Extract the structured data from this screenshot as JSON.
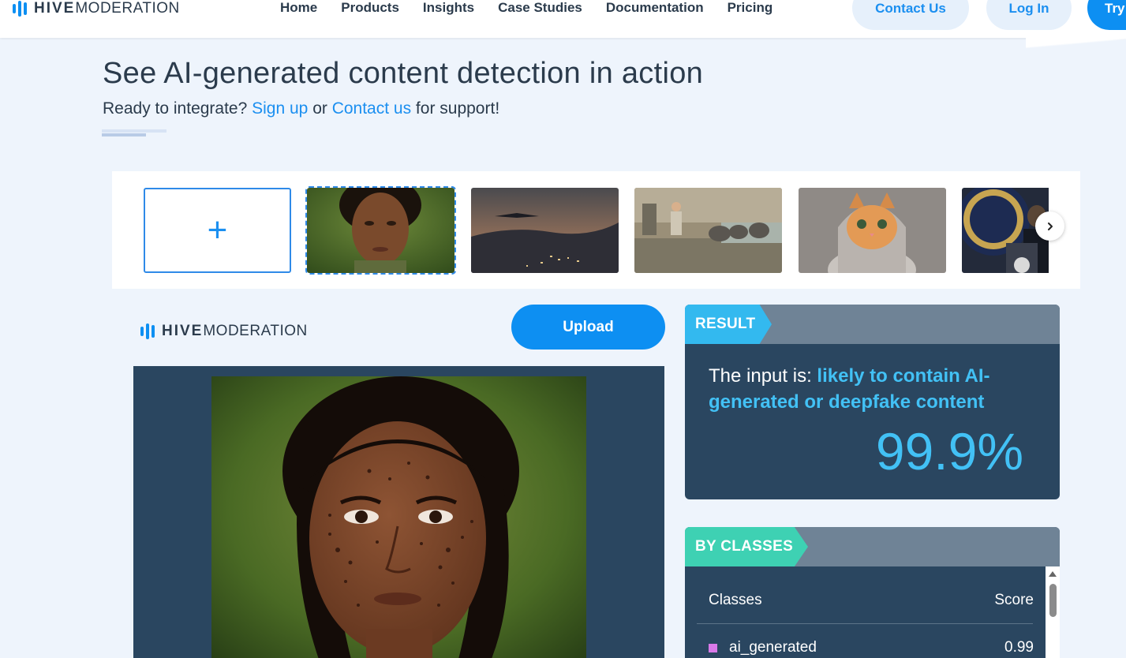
{
  "brand": {
    "bold": "HIVE",
    "light": "MODERATION"
  },
  "nav": {
    "items": [
      "Home",
      "Products",
      "Insights",
      "Case Studies",
      "Documentation",
      "Pricing"
    ],
    "contact": "Contact Us",
    "login": "Log In",
    "try": "Try"
  },
  "hero": {
    "title": "See AI-generated content detection in action",
    "sub_prefix": "Ready to integrate? ",
    "sign_up": "Sign up",
    "sub_mid": " or ",
    "contact_us": "Contact us",
    "sub_suffix": " for support!"
  },
  "carousel": {
    "add_symbol": "+",
    "next_symbol": "›"
  },
  "demo": {
    "upload_label": "Upload"
  },
  "result": {
    "tag": "RESULT",
    "prefix": "The input is: ",
    "verdict": "likely to contain AI-generated or deepfake content",
    "percent": "99.9%"
  },
  "classes": {
    "tag": "BY CLASSES",
    "col_class": "Classes",
    "col_score": "Score",
    "rows": [
      {
        "name": "ai_generated",
        "score": "0.99"
      }
    ]
  },
  "colors": {
    "accent": "#0d8ff2",
    "result_tag": "#33b9ef",
    "classes_tag": "#3ed1b3",
    "card_bg": "#2a4660",
    "class_swatch": "#d979e8"
  },
  "icons": {
    "logo": "hive-bars-icon",
    "add": "plus-icon",
    "next": "chevron-right-icon"
  }
}
